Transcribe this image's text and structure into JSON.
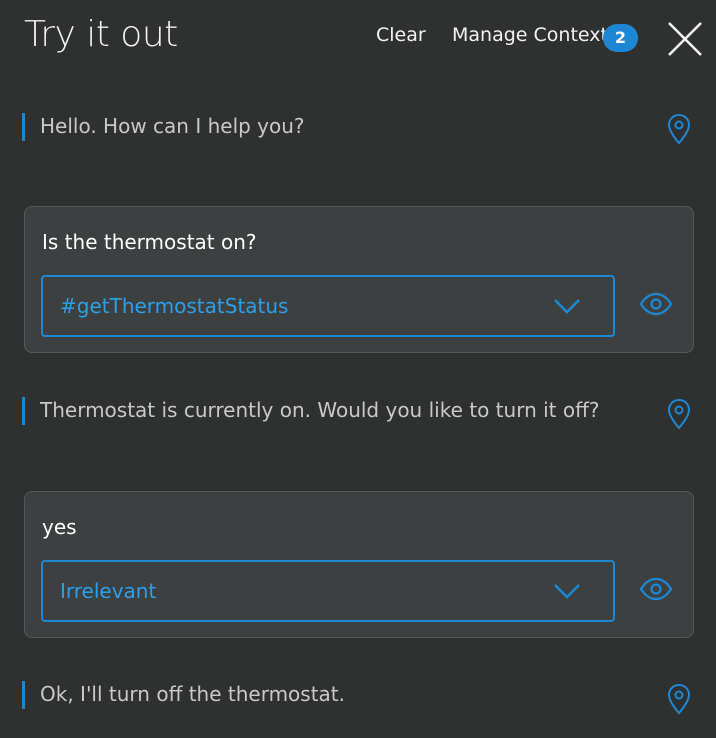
{
  "header": {
    "title": "Try it out",
    "clear_label": "Clear",
    "manage_context_label": "Manage Context",
    "context_count": "2",
    "close_icon": "close-icon"
  },
  "conversation": [
    {
      "type": "bot",
      "text": "Hello. How can I help you?",
      "icon": "location-pin-icon"
    },
    {
      "type": "user",
      "text": "Is the thermostat on?",
      "intent": "#getThermostatStatus",
      "icon": "eye-icon"
    },
    {
      "type": "bot",
      "text": "Thermostat is currently on. Would you like to turn it off?",
      "icon": "location-pin-icon"
    },
    {
      "type": "user",
      "text": "yes",
      "intent": "Irrelevant",
      "icon": "eye-icon"
    },
    {
      "type": "bot",
      "text": "Ok, I'll turn off the thermostat.",
      "icon": "location-pin-icon"
    }
  ],
  "colors": {
    "background": "#2f3030",
    "card": "#3d4040",
    "accent": "#1e87d4",
    "intent_text": "#2d9fea"
  }
}
